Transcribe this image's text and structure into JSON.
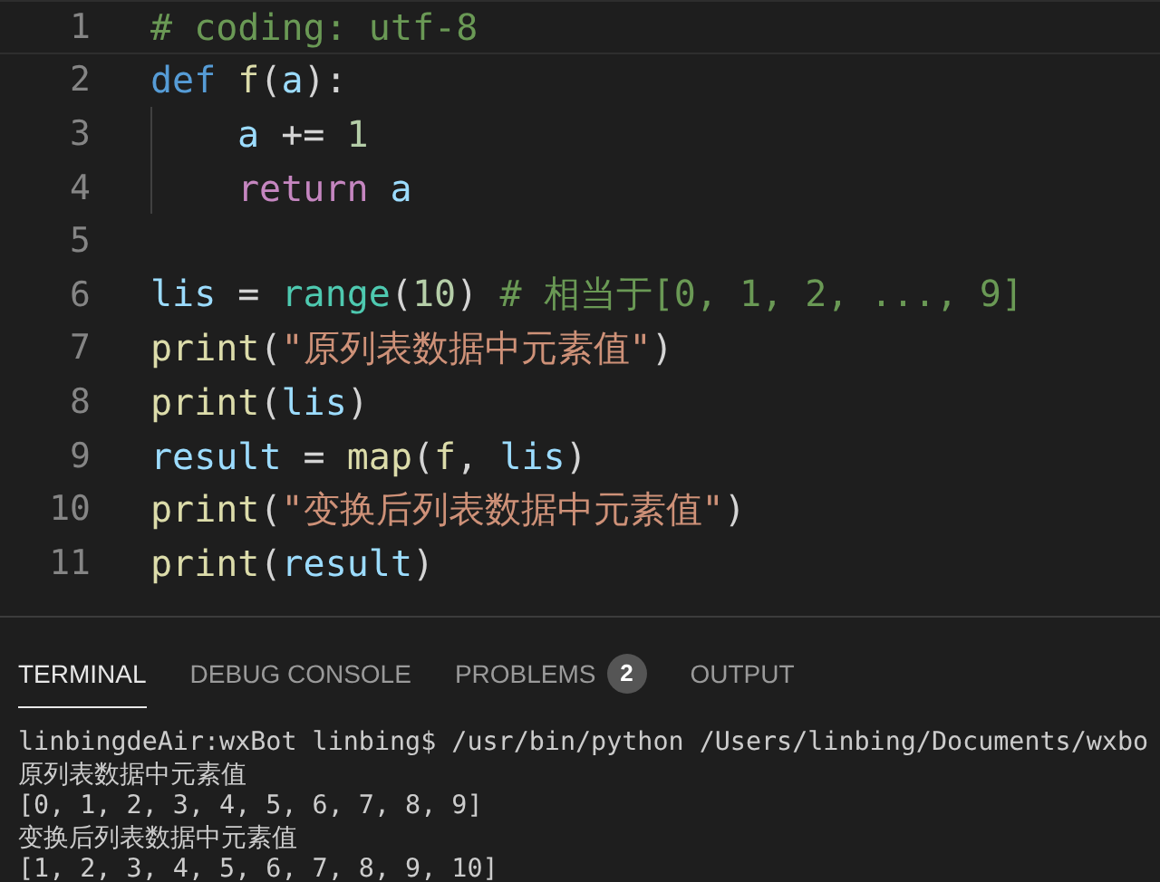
{
  "editor": {
    "lines": [
      {
        "number": "1",
        "current": true,
        "tokens": [
          {
            "text": "# coding: utf-8",
            "kind": "comment"
          }
        ]
      },
      {
        "number": "2",
        "current": false,
        "tokens": [
          {
            "text": "def ",
            "kind": "keyword"
          },
          {
            "text": "f",
            "kind": "function"
          },
          {
            "text": "(",
            "kind": "plain"
          },
          {
            "text": "a",
            "kind": "variable"
          },
          {
            "text": "):",
            "kind": "plain"
          }
        ]
      },
      {
        "number": "3",
        "current": false,
        "indented": true,
        "tokens": [
          {
            "text": "a",
            "kind": "variable"
          },
          {
            "text": " += ",
            "kind": "plain"
          },
          {
            "text": "1",
            "kind": "number"
          }
        ]
      },
      {
        "number": "4",
        "current": false,
        "indented": true,
        "tokens": [
          {
            "text": "return ",
            "kind": "control"
          },
          {
            "text": "a",
            "kind": "variable"
          }
        ]
      },
      {
        "number": "5",
        "current": false
      },
      {
        "number": "6",
        "current": false,
        "tokens": [
          {
            "text": "lis",
            "kind": "variable"
          },
          {
            "text": " = ",
            "kind": "plain"
          },
          {
            "text": "range",
            "kind": "builtin"
          },
          {
            "text": "(",
            "kind": "plain"
          },
          {
            "text": "10",
            "kind": "number"
          },
          {
            "text": ") ",
            "kind": "plain"
          },
          {
            "text": "# 相当于[0, 1, 2, ..., 9]",
            "kind": "comment"
          }
        ]
      },
      {
        "number": "7",
        "current": false,
        "tokens": [
          {
            "text": "print",
            "kind": "function"
          },
          {
            "text": "(",
            "kind": "plain"
          },
          {
            "text": "\"原列表数据中元素值\"",
            "kind": "string"
          },
          {
            "text": ")",
            "kind": "plain"
          }
        ]
      },
      {
        "number": "8",
        "current": false,
        "tokens": [
          {
            "text": "print",
            "kind": "function"
          },
          {
            "text": "(",
            "kind": "plain"
          },
          {
            "text": "lis",
            "kind": "variable"
          },
          {
            "text": ")",
            "kind": "plain"
          }
        ]
      },
      {
        "number": "9",
        "current": false,
        "tokens": [
          {
            "text": "result",
            "kind": "variable"
          },
          {
            "text": " = ",
            "kind": "plain"
          },
          {
            "text": "map",
            "kind": "function"
          },
          {
            "text": "(",
            "kind": "plain"
          },
          {
            "text": "f",
            "kind": "function"
          },
          {
            "text": ", ",
            "kind": "plain"
          },
          {
            "text": "lis",
            "kind": "variable"
          },
          {
            "text": ")",
            "kind": "plain"
          }
        ]
      },
      {
        "number": "10",
        "current": false,
        "tokens": [
          {
            "text": "print",
            "kind": "function"
          },
          {
            "text": "(",
            "kind": "plain"
          },
          {
            "text": "\"变换后列表数据中元素值\"",
            "kind": "string"
          },
          {
            "text": ")",
            "kind": "plain"
          }
        ]
      },
      {
        "number": "11",
        "current": false,
        "tokens": [
          {
            "text": "print",
            "kind": "function"
          },
          {
            "text": "(",
            "kind": "plain"
          },
          {
            "text": "result",
            "kind": "variable"
          },
          {
            "text": ")",
            "kind": "plain"
          }
        ]
      }
    ]
  },
  "panel": {
    "tabs": [
      {
        "label": "TERMINAL",
        "selected": true
      },
      {
        "label": "DEBUG CONSOLE",
        "selected": false
      },
      {
        "label": "PROBLEMS",
        "selected": false,
        "badge": "2"
      },
      {
        "label": "OUTPUT",
        "selected": false
      }
    ],
    "terminal": {
      "lines": [
        "linbingdeAir:wxBot linbing$ /usr/bin/python /Users/linbing/Documents/wxbo",
        "原列表数据中元素值",
        "[0, 1, 2, 3, 4, 5, 6, 7, 8, 9]",
        "变换后列表数据中元素值",
        "[1, 2, 3, 4, 5, 6, 7, 8, 9, 10]"
      ]
    }
  }
}
